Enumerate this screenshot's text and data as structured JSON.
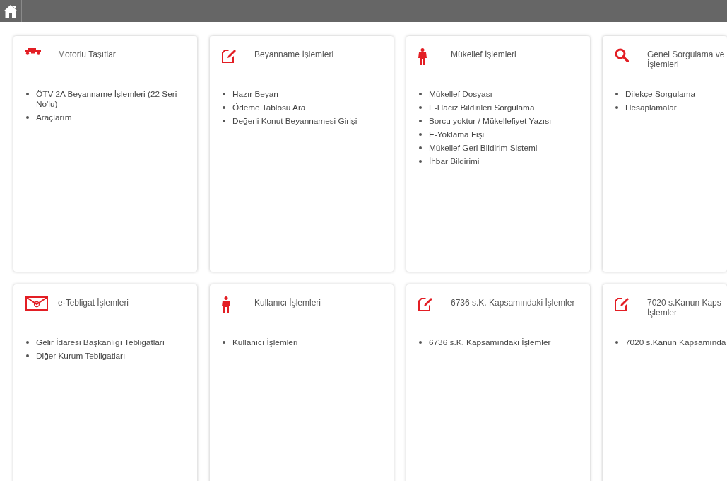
{
  "cards": [
    {
      "kind": "vehicle",
      "title_lines": [
        "Motorlu Taşıtlar"
      ],
      "items": [
        "ÖTV 2A Beyanname İşlemleri (22 Seri No'lu)",
        "Araçlarım"
      ]
    },
    {
      "kind": "edit",
      "title_lines": [
        "Beyanname İşlemleri"
      ],
      "items": [
        "Hazır Beyan",
        "Ödeme Tablosu Ara",
        "Değerli Konut Beyannamesi Girişi"
      ]
    },
    {
      "kind": "person",
      "title_lines": [
        "Mükellef İşlemleri"
      ],
      "items": [
        "Mükellef Dosyası",
        "E-Haciz Bildirileri Sorgulama",
        "Borcu yoktur / Mükellefiyet Yazısı",
        "E-Yoklama Fişi",
        "Mükellef Geri Bildirim Sistemi",
        "İhbar Bildirimi"
      ]
    },
    {
      "kind": "search",
      "title_lines": [
        "Genel Sorgulama ve",
        "İşlemleri"
      ],
      "items": [
        "Dilekçe Sorgulama",
        "Hesaplamalar"
      ]
    },
    {
      "kind": "mail",
      "title_lines": [
        "e-Tebligat İşlemleri"
      ],
      "items": [
        "Gelir İdaresi Başkanlığı Tebligatları",
        "Diğer Kurum Tebligatları"
      ]
    },
    {
      "kind": "person",
      "title_lines": [
        "Kullanıcı İşlemleri"
      ],
      "items": [
        "Kullanıcı İşlemleri"
      ]
    },
    {
      "kind": "edit",
      "title_lines": [
        "6736 s.K. Kapsamındaki İşlemler"
      ],
      "items": [
        "6736 s.K. Kapsamındaki İşlemler"
      ]
    },
    {
      "kind": "edit",
      "title_lines": [
        "7020 s.Kanun Kaps",
        "İşlemler"
      ],
      "items": [
        "7020 s.Kanun Kapsamında"
      ]
    }
  ]
}
